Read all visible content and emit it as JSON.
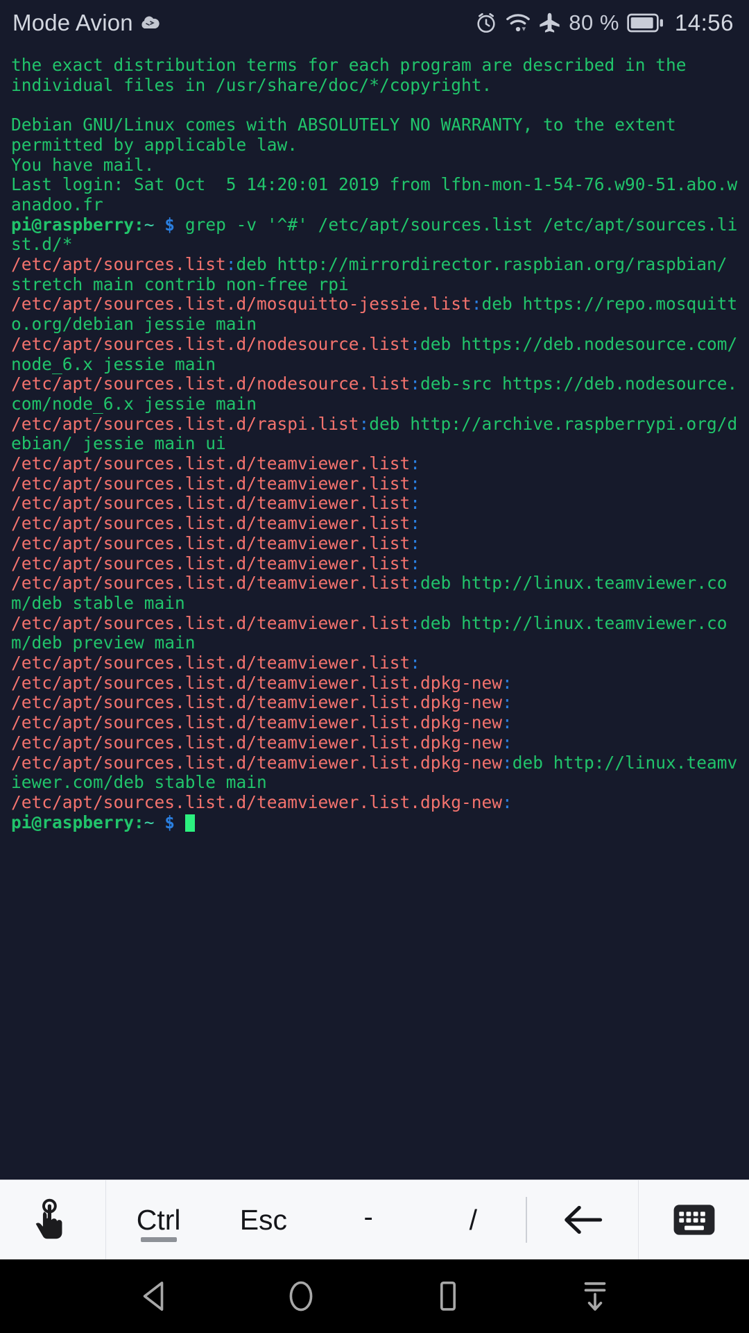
{
  "statusbar": {
    "title": "Mode Avion",
    "cloud_icon": "cloud-icon",
    "alarm_icon": "alarm-clock-icon",
    "wifi_icon": "wifi-icon",
    "airplane_icon": "airplane-mode-icon",
    "battery_percent": "80 %",
    "battery_icon": "battery-icon",
    "time": "14:56"
  },
  "terminal": {
    "background": "#161a2b",
    "output_color": "#21c46b",
    "filename_color": "#f4736e",
    "separator_color": "#2a7fe0",
    "cursor_color": "#2cf07f",
    "lines": [
      {
        "id": "l01",
        "parts": [
          {
            "t": "the exact distribution terms for each program are described in the",
            "c": "g"
          }
        ]
      },
      {
        "id": "l02",
        "parts": [
          {
            "t": "individual files in /usr/share/doc/*/copyright.",
            "c": "g"
          }
        ]
      },
      {
        "id": "l03",
        "parts": [
          {
            "t": "",
            "c": "g"
          }
        ]
      },
      {
        "id": "l04",
        "parts": [
          {
            "t": "Debian GNU/Linux comes with ABSOLUTELY NO WARRANTY, to the extent",
            "c": "g"
          }
        ]
      },
      {
        "id": "l05",
        "parts": [
          {
            "t": "permitted by applicable law.",
            "c": "g"
          }
        ]
      },
      {
        "id": "l06",
        "parts": [
          {
            "t": "You have mail.",
            "c": "g"
          }
        ]
      },
      {
        "id": "l07",
        "parts": [
          {
            "t": "Last login: Sat Oct  5 14:20:01 2019 from lfbn-mon-1-54-76.w90-51.abo.wanadoo.fr",
            "c": "g"
          }
        ]
      },
      {
        "id": "l08",
        "parts": [
          {
            "t": "pi@raspberry:",
            "c": "pr"
          },
          {
            "t": "~",
            "c": "tl"
          },
          {
            "t": " ",
            "c": "g"
          },
          {
            "t": "$",
            "c": "dl"
          },
          {
            "t": " grep -v '^#' /etc/apt/sources.list /etc/apt/sources.list.d/*",
            "c": "g"
          }
        ]
      },
      {
        "id": "l09",
        "parts": [
          {
            "t": "/etc/apt/sources.list",
            "c": "fn"
          },
          {
            "t": ":",
            "c": "sep"
          },
          {
            "t": "deb http://mirrordirector.raspbian.org/raspbian/ stretch main contrib non-free rpi",
            "c": "g"
          }
        ]
      },
      {
        "id": "l10",
        "parts": [
          {
            "t": "/etc/apt/sources.list.d/mosquitto-jessie.list",
            "c": "fn"
          },
          {
            "t": ":",
            "c": "sep"
          },
          {
            "t": "deb https://repo.mosquitto.org/debian jessie main",
            "c": "g"
          }
        ]
      },
      {
        "id": "l11",
        "parts": [
          {
            "t": "/etc/apt/sources.list.d/nodesource.list",
            "c": "fn"
          },
          {
            "t": ":",
            "c": "sep"
          },
          {
            "t": "deb https://deb.nodesource.com/node_6.x jessie main",
            "c": "g"
          }
        ]
      },
      {
        "id": "l12",
        "parts": [
          {
            "t": "/etc/apt/sources.list.d/nodesource.list",
            "c": "fn"
          },
          {
            "t": ":",
            "c": "sep"
          },
          {
            "t": "deb-src https://deb.nodesource.com/node_6.x jessie main",
            "c": "g"
          }
        ]
      },
      {
        "id": "l13",
        "parts": [
          {
            "t": "/etc/apt/sources.list.d/raspi.list",
            "c": "fn"
          },
          {
            "t": ":",
            "c": "sep"
          },
          {
            "t": "deb http://archive.raspberrypi.org/debian/ jessie main ui",
            "c": "g"
          }
        ]
      },
      {
        "id": "l14",
        "parts": [
          {
            "t": "/etc/apt/sources.list.d/teamviewer.list",
            "c": "fn"
          },
          {
            "t": ":",
            "c": "sep"
          }
        ]
      },
      {
        "id": "l15",
        "parts": [
          {
            "t": "/etc/apt/sources.list.d/teamviewer.list",
            "c": "fn"
          },
          {
            "t": ":",
            "c": "sep"
          }
        ]
      },
      {
        "id": "l16",
        "parts": [
          {
            "t": "/etc/apt/sources.list.d/teamviewer.list",
            "c": "fn"
          },
          {
            "t": ":",
            "c": "sep"
          }
        ]
      },
      {
        "id": "l17",
        "parts": [
          {
            "t": "/etc/apt/sources.list.d/teamviewer.list",
            "c": "fn"
          },
          {
            "t": ":",
            "c": "sep"
          }
        ]
      },
      {
        "id": "l18",
        "parts": [
          {
            "t": "/etc/apt/sources.list.d/teamviewer.list",
            "c": "fn"
          },
          {
            "t": ":",
            "c": "sep"
          }
        ]
      },
      {
        "id": "l19",
        "parts": [
          {
            "t": "/etc/apt/sources.list.d/teamviewer.list",
            "c": "fn"
          },
          {
            "t": ":",
            "c": "sep"
          }
        ]
      },
      {
        "id": "l20",
        "parts": [
          {
            "t": "/etc/apt/sources.list.d/teamviewer.list",
            "c": "fn"
          },
          {
            "t": ":",
            "c": "sep"
          },
          {
            "t": "deb http://linux.teamviewer.com/deb stable main",
            "c": "g"
          }
        ]
      },
      {
        "id": "l21",
        "parts": [
          {
            "t": "/etc/apt/sources.list.d/teamviewer.list",
            "c": "fn"
          },
          {
            "t": ":",
            "c": "sep"
          },
          {
            "t": "deb http://linux.teamviewer.com/deb preview main",
            "c": "g"
          }
        ]
      },
      {
        "id": "l22",
        "parts": [
          {
            "t": "/etc/apt/sources.list.d/teamviewer.list",
            "c": "fn"
          },
          {
            "t": ":",
            "c": "sep"
          }
        ]
      },
      {
        "id": "l23",
        "parts": [
          {
            "t": "/etc/apt/sources.list.d/teamviewer.list.dpkg-new",
            "c": "fn"
          },
          {
            "t": ":",
            "c": "sep"
          }
        ]
      },
      {
        "id": "l24",
        "parts": [
          {
            "t": "/etc/apt/sources.list.d/teamviewer.list.dpkg-new",
            "c": "fn"
          },
          {
            "t": ":",
            "c": "sep"
          }
        ]
      },
      {
        "id": "l25",
        "parts": [
          {
            "t": "/etc/apt/sources.list.d/teamviewer.list.dpkg-new",
            "c": "fn"
          },
          {
            "t": ":",
            "c": "sep"
          }
        ]
      },
      {
        "id": "l26",
        "parts": [
          {
            "t": "/etc/apt/sources.list.d/teamviewer.list.dpkg-new",
            "c": "fn"
          },
          {
            "t": ":",
            "c": "sep"
          }
        ]
      },
      {
        "id": "l27",
        "parts": [
          {
            "t": "/etc/apt/sources.list.d/teamviewer.list.dpkg-new",
            "c": "fn"
          },
          {
            "t": ":",
            "c": "sep"
          },
          {
            "t": "deb http://linux.teamviewer.com/deb stable main",
            "c": "g"
          }
        ]
      },
      {
        "id": "l28",
        "parts": [
          {
            "t": "/etc/apt/sources.list.d/teamviewer.list.dpkg-new",
            "c": "fn"
          },
          {
            "t": ":",
            "c": "sep"
          }
        ]
      },
      {
        "id": "l29",
        "parts": [
          {
            "t": "pi@raspberry:",
            "c": "pr"
          },
          {
            "t": "~",
            "c": "tl"
          },
          {
            "t": " ",
            "c": "g"
          },
          {
            "t": "$",
            "c": "dl"
          },
          {
            "t": " ",
            "c": "g"
          }
        ],
        "cursor": true
      }
    ]
  },
  "keybar": {
    "background": "#f7f8fa",
    "touch_icon": "touch-pointer-icon",
    "keys": [
      {
        "label": "Ctrl",
        "name": "key-ctrl",
        "active": true
      },
      {
        "label": "Esc",
        "name": "key-esc",
        "active": false
      },
      {
        "label": "-",
        "name": "key-dash",
        "active": false
      },
      {
        "label": "/",
        "name": "key-slash",
        "active": false
      }
    ],
    "back_icon": "arrow-left-icon",
    "keyboard_icon": "keyboard-icon"
  },
  "navbar": {
    "background": "#000000",
    "back_icon": "nav-back-triangle-icon",
    "home_icon": "nav-home-circle-icon",
    "recents_icon": "nav-recents-square-icon",
    "hide_icon": "nav-hide-bar-icon"
  }
}
